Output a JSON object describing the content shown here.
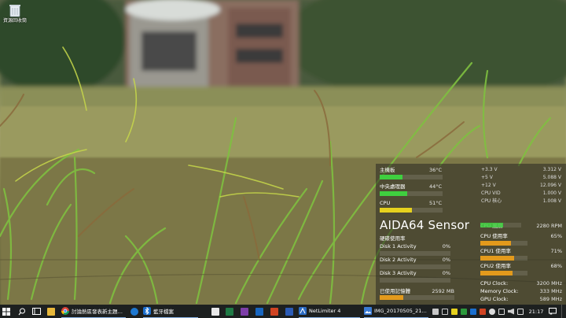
{
  "desktop": {
    "recycle_bin_label": "資源回收筒"
  },
  "aida64": {
    "title": "AIDA64 Sensor",
    "colors": {
      "green": "#3fcf3f",
      "orange": "#e39a1c",
      "yellow": "#e6d11e"
    },
    "temps": [
      {
        "label": "主機板",
        "value": "36°C",
        "level": 0.36
      },
      {
        "label": "中央處理器",
        "value": "44°C",
        "level": 0.44
      },
      {
        "label": "CPU",
        "value": "51°C",
        "level": 0.51
      }
    ],
    "voltages": [
      {
        "label": "+3.3 V",
        "value": "3.312 V"
      },
      {
        "label": "+5 V",
        "value": "5.088 V"
      },
      {
        "label": "+12 V",
        "value": "12.096 V"
      },
      {
        "label": "CPU VID",
        "value": "1.000 V"
      },
      {
        "label": "CPU 核心",
        "value": "1.008 V"
      }
    ],
    "disks": [
      {
        "label": "硬碟使用率",
        "value": ""
      },
      {
        "label": "Disk 1 Activity",
        "value": "0%",
        "level": 0
      },
      {
        "label": "Disk 2 Activity",
        "value": "0%",
        "level": 0
      },
      {
        "label": "Disk 3 Activity",
        "value": "0%",
        "level": 0
      }
    ],
    "memory": {
      "label": "已使用記憶體",
      "value": "2592 MB",
      "level": 0.32
    },
    "cpu_stats": [
      {
        "label": "CPU 風扇",
        "value": "2280 RPM",
        "level": 0.55,
        "color": "green"
      },
      {
        "label": "CPU 使用率",
        "value": "65%",
        "level": 0.65,
        "color": "orange"
      },
      {
        "label": "CPU1 使用率",
        "value": "71%",
        "level": 0.71,
        "color": "orange"
      },
      {
        "label": "CPU2 使用率",
        "value": "68%",
        "level": 0.68,
        "color": "orange"
      }
    ],
    "clocks": [
      {
        "label": "CPU Clock:",
        "value": "3200 MHz"
      },
      {
        "label": "Memory Clock:",
        "value": "333 MHz"
      },
      {
        "label": "GPU Clock:",
        "value": "589 MHz"
      }
    ]
  },
  "taskbar": {
    "start_icon": "windows-logo-icon",
    "apps": [
      {
        "label": "討論熱區發表新主題…",
        "icon": "chrome-icon"
      },
      {
        "label": "藍牙檔案",
        "icon": "bluetooth-icon"
      },
      {
        "label": "NetLimiter 4",
        "icon": "netlimiter-icon"
      },
      {
        "label": "IMG_20170505_21…",
        "icon": "photos-icon"
      }
    ],
    "clock": "21:17"
  }
}
